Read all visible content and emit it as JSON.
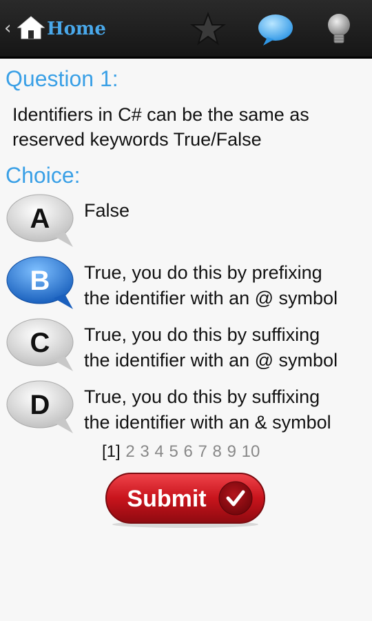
{
  "header": {
    "back_glyph": "‹",
    "home_label": "Home",
    "icons": [
      "star-icon",
      "speech-bubble-icon",
      "lightbulb-icon"
    ]
  },
  "question": {
    "title": "Question 1:",
    "text": "Identifiers in C# can be the same as reserved keywords True/False"
  },
  "choice_title": "Choice:",
  "choices": [
    {
      "letter": "A",
      "lines": [
        "False"
      ],
      "selected": false
    },
    {
      "letter": "B",
      "lines": [
        "True, you do this by prefixing",
        "the identifier with an @ symbol"
      ],
      "selected": true
    },
    {
      "letter": "C",
      "lines": [
        "True, you do this by suffixing",
        "the identifier with an @ symbol"
      ],
      "selected": false
    },
    {
      "letter": "D",
      "lines": [
        "True, you do this by suffixing",
        "the identifier with an & symbol"
      ],
      "selected": false
    }
  ],
  "pager": {
    "current": "[1]",
    "pages": [
      "2",
      "3",
      "4",
      "5",
      "6",
      "7",
      "8",
      "9",
      "10"
    ]
  },
  "submit": {
    "label": "Submit"
  },
  "colors": {
    "accent": "#3aa0e6",
    "selected": "#1f6fcf",
    "submit": "#c8141c"
  }
}
